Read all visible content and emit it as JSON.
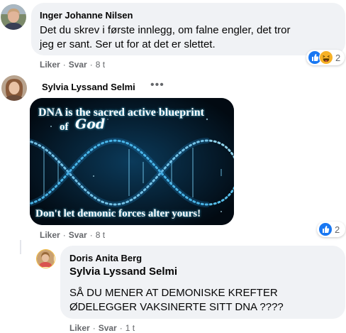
{
  "comments": [
    {
      "author": "Inger Johanne Nilsen",
      "text_line1": "Det du skrev i første innlegg, om falne engler, det tror",
      "text_line2": "jeg er sant. Ser ut for at det er slettet.",
      "like_label": "Liker",
      "reply_label": "Svar",
      "time": "8 t",
      "reaction_count": "2",
      "reaction_icons": [
        "like-icon",
        "haha-icon"
      ]
    },
    {
      "author": "Sylvia Lyssand Selmi",
      "more_label": "•••",
      "image": {
        "title_line": "DNA is the sacred active blueprint",
        "of_text": "of",
        "god_text": "God",
        "bottom_line": "Don't let demonic forces alter yours!"
      },
      "like_label": "Liker",
      "reply_label": "Svar",
      "time": "8 t",
      "reaction_count": "2",
      "reaction_icons": [
        "like-icon"
      ]
    },
    {
      "author": "Doris Anita Berg",
      "mention": "Sylvia Lyssand Selmi",
      "text_line1": "SÅ DU MENER AT DEMONISKE KREFTER",
      "text_line2": "ØDELEGGER VAKSINERTE SITT DNA ????",
      "like_label": "Liker",
      "reply_label": "Svar",
      "time": "1 t"
    }
  ],
  "separator": "·",
  "colors": {
    "bubble": "#f0f2f5",
    "meta": "#65676b",
    "like_blue": "#1877f2",
    "haha_yellow": "#f7b125"
  }
}
